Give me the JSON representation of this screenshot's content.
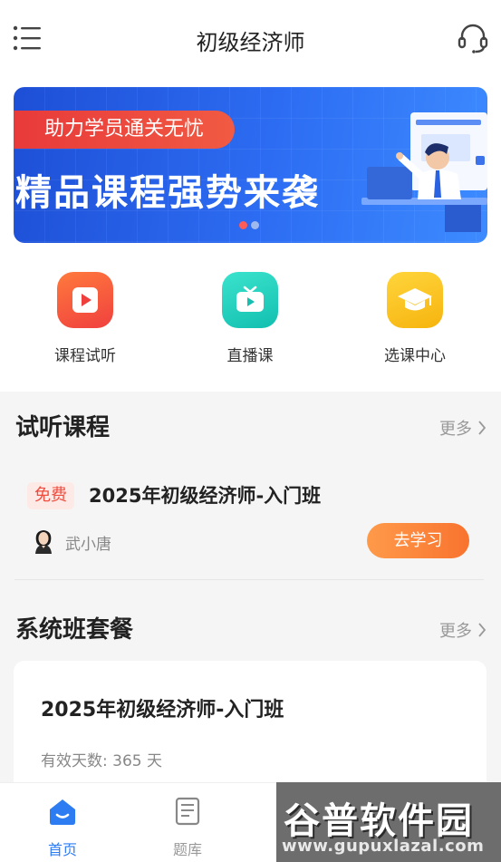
{
  "header": {
    "title": "初级经济师"
  },
  "banner": {
    "tagline": "助力学员通关无忧",
    "headline": "精品课程强势来袭",
    "slide_count": 2,
    "active_slide": 1
  },
  "quick_actions": [
    {
      "label": "课程试听",
      "icon": "play-icon"
    },
    {
      "label": "直播课",
      "icon": "tv-icon"
    },
    {
      "label": "选课中心",
      "icon": "graduation-cap-icon"
    }
  ],
  "trial_section": {
    "title": "试听课程",
    "more_label": "更多",
    "course": {
      "badge": "免费",
      "title": "2025年初级经济师-入门班",
      "teacher": "武小唐",
      "action_label": "去学习"
    }
  },
  "package_section": {
    "title": "系统班套餐",
    "more_label": "更多",
    "card": {
      "title": "2025年初级经济师-入门班",
      "validity": "有效天数: 365 天"
    }
  },
  "tabbar": {
    "tabs": [
      {
        "label": "首页",
        "icon": "home-icon",
        "active": true
      },
      {
        "label": "题库",
        "icon": "question-bank-icon",
        "active": false
      }
    ]
  },
  "watermark": {
    "brand": "谷普软件园",
    "url": "www.gupuxlazal.com"
  },
  "colors": {
    "accent": "#2d7cf2",
    "orange": "#f8732f",
    "red": "#ef4d3f"
  }
}
